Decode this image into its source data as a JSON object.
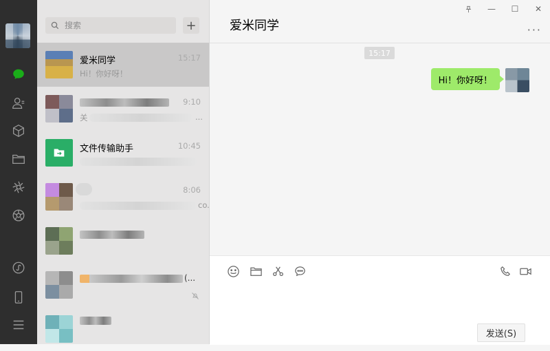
{
  "search": {
    "placeholder": "搜索",
    "add_label": "+"
  },
  "chats": [
    {
      "name": "爱米同学",
      "preview": "Hi！你好呀！",
      "time": "15:17",
      "selected": true
    },
    {
      "name": "",
      "preview": "关",
      "time": "9:10",
      "preview_tail": "..."
    },
    {
      "name": "文件传输助手",
      "preview": "",
      "time": "10:45"
    },
    {
      "name": "",
      "preview": "",
      "time": "8:06",
      "preview_tail": "co..."
    },
    {
      "name": "",
      "preview": "",
      "time": ""
    },
    {
      "name": "",
      "preview": "",
      "time": "",
      "name_tail": "(..."
    },
    {
      "name": "",
      "preview": "",
      "time": ""
    }
  ],
  "window": {
    "title": "爱米同学",
    "pin": "⊥",
    "min": "—",
    "max": "☐",
    "close": "✕",
    "more": "···"
  },
  "conversation": {
    "timestamp": "15:17",
    "messages": [
      {
        "from": "me",
        "text": "Hi！你好呀！"
      }
    ]
  },
  "composer": {
    "send_label": "发送(S)"
  },
  "colors": {
    "nav_bg": "#2e2e2e",
    "accent": "#1aad19",
    "bubble": "#9eea6a",
    "list_bg": "#e6e5e5"
  }
}
